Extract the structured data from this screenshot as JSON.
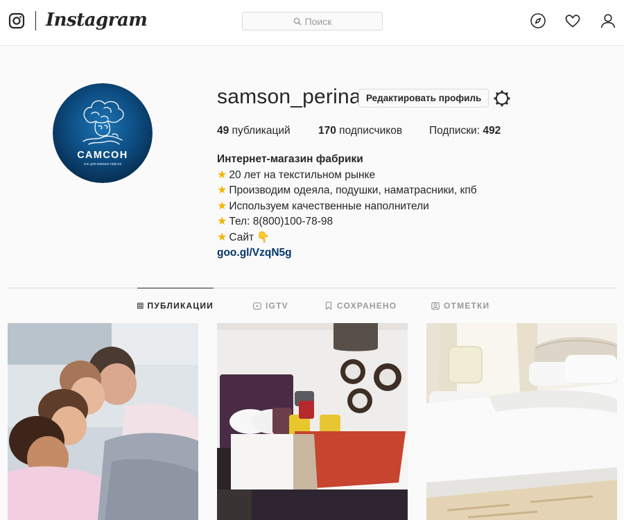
{
  "header": {
    "wordmark": "Instagram",
    "search_placeholder": "Поиск",
    "icons": [
      "instagram-logo-icon",
      "search-icon",
      "compass-icon",
      "heart-icon",
      "user-icon"
    ]
  },
  "profile": {
    "username": "samson_perina",
    "edit_button": "Редактировать профиль",
    "avatar_brand": "САМСОН",
    "avatar_tagline": "сон для важных персон",
    "stats": {
      "posts_count": "49",
      "posts_label": " публикаций",
      "followers_count": "170",
      "followers_label": " подписчиков",
      "following_label": "Подписки: ",
      "following_count": "492"
    },
    "bio": {
      "name": "Интернет-магазин фабрики",
      "lines": [
        "20 лет на текстильном рынке",
        "Производим одеяла, подушки, наматрасники, кпб",
        "Используем качественные наполнители",
        "Тел: 8(800)100-78-98",
        "Сайт 👇"
      ],
      "link": "goo.gl/VzqN5g"
    }
  },
  "tabs": [
    {
      "label": "ПУБЛИКАЦИИ",
      "icon": "grid-icon",
      "active": true
    },
    {
      "label": "IGTV",
      "icon": "tv-icon",
      "active": false
    },
    {
      "label": "СОХРАНЕНО",
      "icon": "bookmark-icon",
      "active": false
    },
    {
      "label": "ОТМЕТКИ",
      "icon": "tag-icon",
      "active": false
    }
  ],
  "colors": {
    "accent_link": "#003569",
    "avatar_blue": "#0d4d82",
    "text": "#262626",
    "muted": "#999999"
  }
}
